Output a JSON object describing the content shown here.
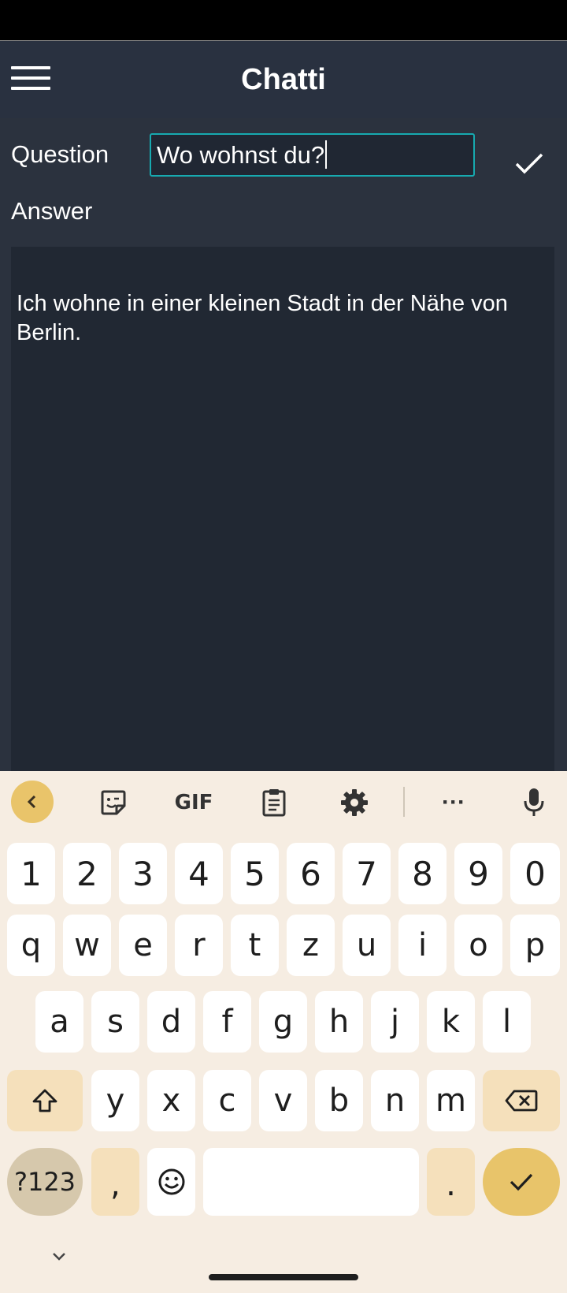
{
  "app": {
    "title": "Chatti"
  },
  "form": {
    "question_label": "Question",
    "question_value": "Wo wohnst du?",
    "answer_label": "Answer",
    "answer_text": "Ich wohne in einer kleinen Stadt in der Nähe von Berlin."
  },
  "keyboard": {
    "toolbar": [
      "back-icon",
      "sticker-icon",
      "GIF",
      "clipboard-icon",
      "gear-icon",
      "more-icon",
      "microphone-icon"
    ],
    "gif_label": "GIF",
    "more_label": "···",
    "number_row": [
      "1",
      "2",
      "3",
      "4",
      "5",
      "6",
      "7",
      "8",
      "9",
      "0"
    ],
    "row1": [
      "q",
      "w",
      "e",
      "r",
      "t",
      "z",
      "u",
      "i",
      "o",
      "p"
    ],
    "row2": [
      "a",
      "s",
      "d",
      "f",
      "g",
      "h",
      "j",
      "k",
      "l"
    ],
    "row3": [
      "y",
      "x",
      "c",
      "v",
      "b",
      "n",
      "m"
    ],
    "symbols_label": "?123",
    "comma_label": ",",
    "period_label": ".",
    "accent_color": "#e8c46a",
    "focus_color": "#17aab0"
  }
}
